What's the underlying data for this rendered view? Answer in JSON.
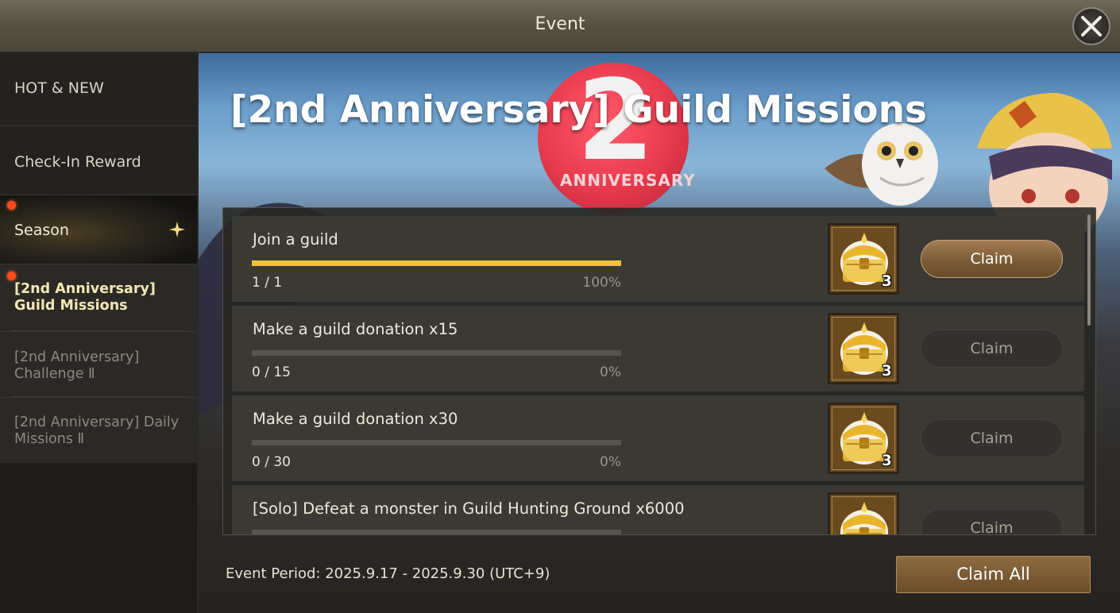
{
  "header": {
    "title": "Event",
    "close_icon": "close-icon"
  },
  "sidebar": {
    "items": [
      {
        "label": "HOT & NEW"
      },
      {
        "label": "Check-In Reward"
      },
      {
        "label": "Season",
        "expand_icon": "star-icon",
        "notification": true
      }
    ],
    "sub_items": [
      {
        "label": "[2nd Anniversary] Guild Missions",
        "selected": true,
        "notification": true
      },
      {
        "label": "[2nd Anniversary] Challenge Ⅱ",
        "selected": false
      },
      {
        "label": "[2nd Anniversary] Daily Missions Ⅱ",
        "selected": false
      }
    ]
  },
  "banner": {
    "title": "[2nd Anniversary] Guild Missions",
    "emblem_number": "2",
    "emblem_text": "ANNIVERSARY"
  },
  "missions": [
    {
      "name": "Join a guild",
      "count": "1 / 1",
      "percent_label": "100%",
      "progress": 1.0,
      "reward_icon": "treasure-chest-icon",
      "reward_qty": "3",
      "claim_label": "Claim",
      "claimable": true
    },
    {
      "name": "Make a guild donation x15",
      "count": "0 / 15",
      "percent_label": "0%",
      "progress": 0.0,
      "reward_icon": "treasure-chest-icon",
      "reward_qty": "3",
      "claim_label": "Claim",
      "claimable": false
    },
    {
      "name": "Make a guild donation x30",
      "count": "0 / 30",
      "percent_label": "0%",
      "progress": 0.0,
      "reward_icon": "treasure-chest-icon",
      "reward_qty": "3",
      "claim_label": "Claim",
      "claimable": false
    },
    {
      "name": "[Solo] Defeat a monster in Guild Hunting Ground x6000",
      "count": "",
      "percent_label": "",
      "progress": 0.0,
      "reward_icon": "treasure-chest-icon",
      "reward_qty": "",
      "claim_label": "Claim",
      "claimable": false
    }
  ],
  "footer": {
    "event_period": "Event Period: 2025.9.17 - 2025.9.30 (UTC+9)",
    "claim_all_label": "Claim All"
  },
  "colors": {
    "progress_fill": "#f2c23b",
    "notification_dot": "#ff4a1a",
    "selected_text": "#f4e7b6",
    "claim_button": "#7a5935"
  }
}
